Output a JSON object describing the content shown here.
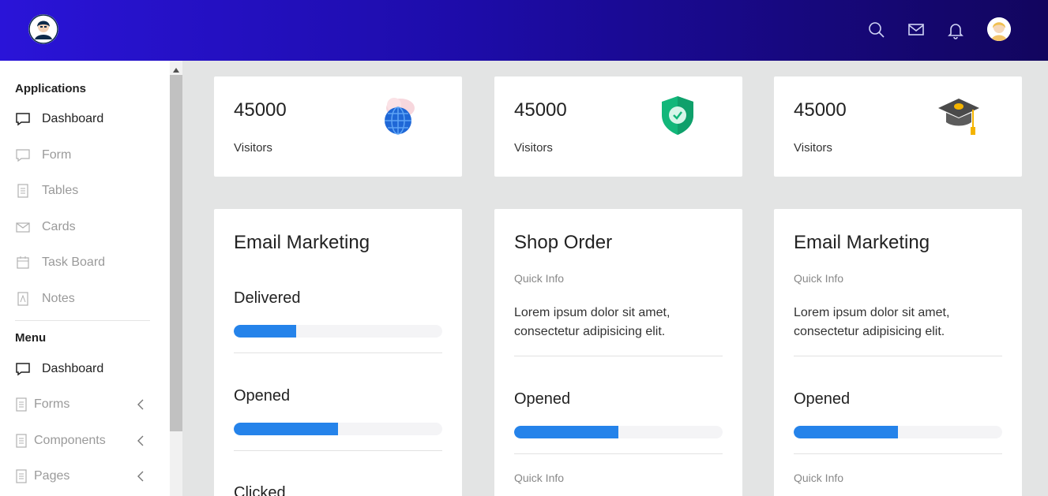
{
  "header": {
    "logo": "admin-avatar-logo",
    "icons": [
      "search-icon",
      "mail-icon",
      "bell-icon",
      "user-avatar"
    ]
  },
  "sidebar": {
    "applications_title": "Applications",
    "applications": [
      {
        "label": "Dashboard",
        "icon": "comment-icon",
        "active": true
      },
      {
        "label": "Form",
        "icon": "comment-icon",
        "active": false
      },
      {
        "label": "Tables",
        "icon": "document-icon",
        "active": false
      },
      {
        "label": "Cards",
        "icon": "mail-icon",
        "active": false
      },
      {
        "label": "Task Board",
        "icon": "calendar-icon",
        "active": false
      },
      {
        "label": "Notes",
        "icon": "pdf-icon",
        "active": false
      }
    ],
    "menu_title": "Menu",
    "menu": [
      {
        "label": "Dashboard",
        "icon": "comment-icon",
        "active": true
      },
      {
        "label": "Forms",
        "icon": "document-icon",
        "expandable": true
      },
      {
        "label": "Components",
        "icon": "document-icon",
        "expandable": true
      },
      {
        "label": "Pages",
        "icon": "document-icon",
        "expandable": true
      }
    ]
  },
  "stats": [
    {
      "value": "45000",
      "label": "Visitors",
      "icon": "globe-cloud-icon"
    },
    {
      "value": "45000",
      "label": "Visitors",
      "icon": "shield-check-icon"
    },
    {
      "value": "45000",
      "label": "Visitors",
      "icon": "graduation-cap-icon"
    }
  ],
  "cards": {
    "email_marketing": {
      "title": "Email Marketing",
      "metrics": [
        {
          "label": "Delivered",
          "progress": 0.3
        },
        {
          "label": "Opened",
          "progress": 0.5
        },
        {
          "label": "Clicked"
        }
      ]
    },
    "shop_order": {
      "title": "Shop Order",
      "quick_info": "Quick Info",
      "text": "Lorem ipsum dolor sit amet, consectetur adipisicing elit.",
      "metric": {
        "label": "Opened",
        "progress": 0.5
      },
      "quick_info_2": "Quick Info"
    },
    "email_marketing_2": {
      "title": "Email Marketing",
      "quick_info": "Quick Info",
      "text": "Lorem ipsum dolor sit amet, consectetur adipisicing elit.",
      "metric": {
        "label": "Opened",
        "progress": 0.5
      },
      "quick_info_2": "Quick Info"
    }
  },
  "colors": {
    "header_gradient_start": "#2a14d8",
    "header_gradient_end": "#12055e",
    "progress": "#2583ea"
  }
}
